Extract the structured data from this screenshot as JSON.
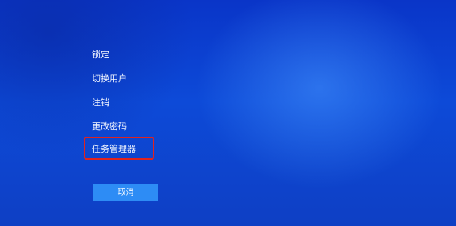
{
  "menu": {
    "items": [
      {
        "label": "锁定"
      },
      {
        "label": "切换用户"
      },
      {
        "label": "注销"
      },
      {
        "label": "更改密码"
      },
      {
        "label": "任务管理器"
      }
    ]
  },
  "cancel_button": {
    "label": "取消"
  },
  "colors": {
    "background": "#0d45d6",
    "highlight_border": "#e0231f",
    "button": "#2d8cf5"
  }
}
